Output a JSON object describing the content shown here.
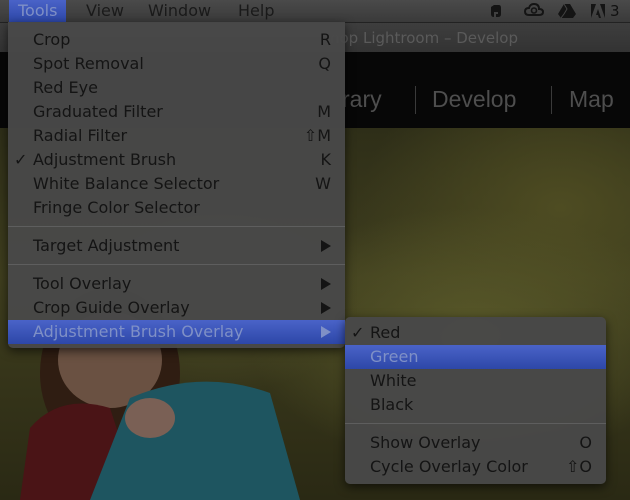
{
  "menubar": {
    "items": [
      "Tools",
      "View",
      "Window",
      "Help"
    ],
    "active": "Tools",
    "status_icons": [
      "evernote-icon",
      "creative-cloud-icon",
      "google-drive-icon",
      "adobe-icon"
    ],
    "partial_text": "3"
  },
  "window": {
    "title": "hop Lightroom – Develop"
  },
  "modules": {
    "items": [
      "rary",
      "Develop",
      "Map"
    ]
  },
  "tools_menu": {
    "groups": [
      [
        {
          "label": "Crop",
          "shortcut": "R",
          "checked": false
        },
        {
          "label": "Spot Removal",
          "shortcut": "Q",
          "checked": false
        },
        {
          "label": "Red Eye",
          "shortcut": "",
          "checked": false
        },
        {
          "label": "Graduated Filter",
          "shortcut": "M",
          "checked": false
        },
        {
          "label": "Radial Filter",
          "shortcut": "⇧M",
          "checked": false
        },
        {
          "label": "Adjustment Brush",
          "shortcut": "K",
          "checked": true
        },
        {
          "label": "White Balance Selector",
          "shortcut": "W",
          "checked": false
        },
        {
          "label": "Fringe Color Selector",
          "shortcut": "",
          "checked": false
        }
      ],
      [
        {
          "label": "Target Adjustment",
          "submenu": true
        }
      ],
      [
        {
          "label": "Tool Overlay",
          "submenu": true
        },
        {
          "label": "Crop Guide Overlay",
          "submenu": true
        },
        {
          "label": "Adjustment Brush Overlay",
          "submenu": true,
          "highlighted": true
        }
      ]
    ]
  },
  "overlay_submenu": {
    "groups": [
      [
        {
          "label": "Red",
          "checked": true
        },
        {
          "label": "Green",
          "highlighted": true
        },
        {
          "label": "White"
        },
        {
          "label": "Black"
        }
      ],
      [
        {
          "label": "Show Overlay",
          "shortcut": "O"
        },
        {
          "label": "Cycle Overlay Color",
          "shortcut": "⇧O"
        }
      ]
    ]
  },
  "check_mark": "✓",
  "colors": {
    "highlight": "#2d47a8",
    "menu_bg": "#484848",
    "text": "#141414",
    "highlight_text": "#7f90c6"
  }
}
